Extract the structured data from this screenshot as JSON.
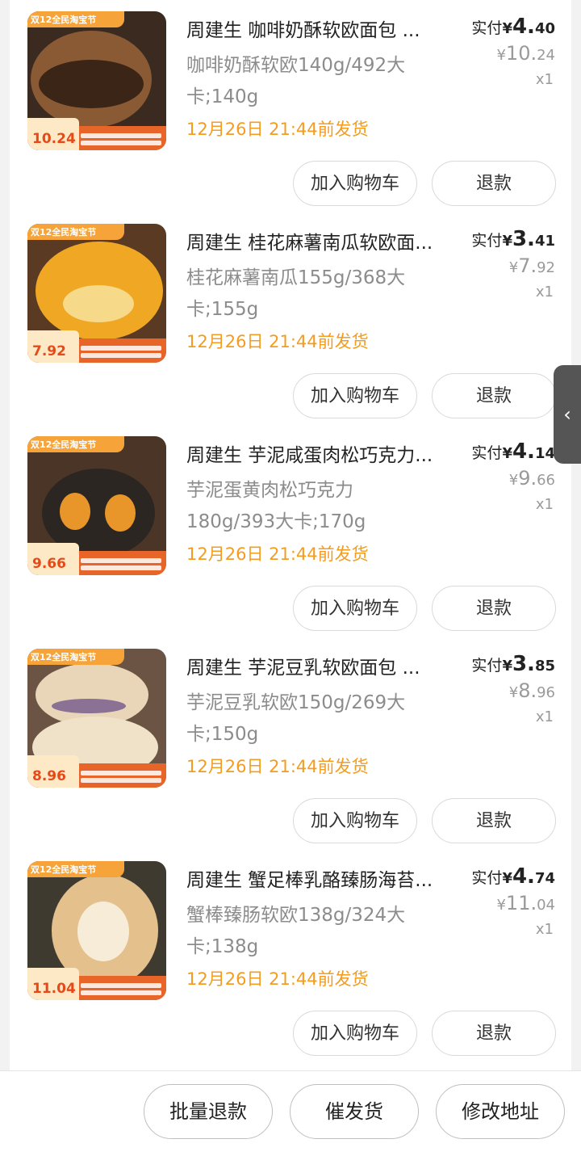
{
  "items": [
    {
      "title": "周建生 咖啡奶酥软欧面包 ...",
      "spec": "咖啡奶酥软欧140g/492大卡;140g",
      "ship": "12月26日 21:44前发货",
      "paid_label": "实付",
      "currency": "¥",
      "paid_int": "4.",
      "paid_dec": "40",
      "orig_int": "10.",
      "orig_dec": "24",
      "qty": "x1",
      "thumb_banner": "双12全民淘宝节",
      "thumb_price": "10.24",
      "cart_label": "加入购物车",
      "refund_label": "退款"
    },
    {
      "title": "周建生 桂花麻薯南瓜软欧面...",
      "spec": "桂花麻薯南瓜155g/368大卡;155g",
      "ship": "12月26日 21:44前发货",
      "paid_label": "实付",
      "currency": "¥",
      "paid_int": "3.",
      "paid_dec": "41",
      "orig_int": "7.",
      "orig_dec": "92",
      "qty": "x1",
      "thumb_banner": "双12全民淘宝节",
      "thumb_price": "7.92",
      "cart_label": "加入购物车",
      "refund_label": "退款"
    },
    {
      "title": "周建生 芋泥咸蛋肉松巧克力...",
      "spec": "芋泥蛋黄肉松巧克力180g/393大卡;170g",
      "ship": "12月26日 21:44前发货",
      "paid_label": "实付",
      "currency": "¥",
      "paid_int": "4.",
      "paid_dec": "14",
      "orig_int": "9.",
      "orig_dec": "66",
      "qty": "x1",
      "thumb_banner": "双12全民淘宝节",
      "thumb_price": "9.66",
      "cart_label": "加入购物车",
      "refund_label": "退款"
    },
    {
      "title": "周建生 芋泥豆乳软欧面包 ...",
      "spec": "芋泥豆乳软欧150g/269大卡;150g",
      "ship": "12月26日 21:44前发货",
      "paid_label": "实付",
      "currency": "¥",
      "paid_int": "3.",
      "paid_dec": "85",
      "orig_int": "8.",
      "orig_dec": "96",
      "qty": "x1",
      "thumb_banner": "双12全民淘宝节",
      "thumb_price": "8.96",
      "cart_label": "加入购物车",
      "refund_label": "退款"
    },
    {
      "title": "周建生 蟹足棒乳酪臻肠海苔...",
      "spec": "蟹棒臻肠软欧138g/324大卡;138g",
      "ship": "12月26日 21:44前发货",
      "paid_label": "实付",
      "currency": "¥",
      "paid_int": "4.",
      "paid_dec": "74",
      "orig_int": "11.",
      "orig_dec": "04",
      "qty": "x1",
      "thumb_banner": "双12全民淘宝节",
      "thumb_price": "11.04",
      "cart_label": "加入购物车",
      "refund_label": "退款"
    }
  ],
  "side_tab": {
    "icon": "chevron-left-icon",
    "glyph": "‹"
  },
  "footer": {
    "batch_refund": "批量退款",
    "urge_ship": "催发货",
    "change_address": "修改地址"
  },
  "colors": {
    "ship_text": "#f39c1f",
    "price_tag": "#e64a19"
  }
}
